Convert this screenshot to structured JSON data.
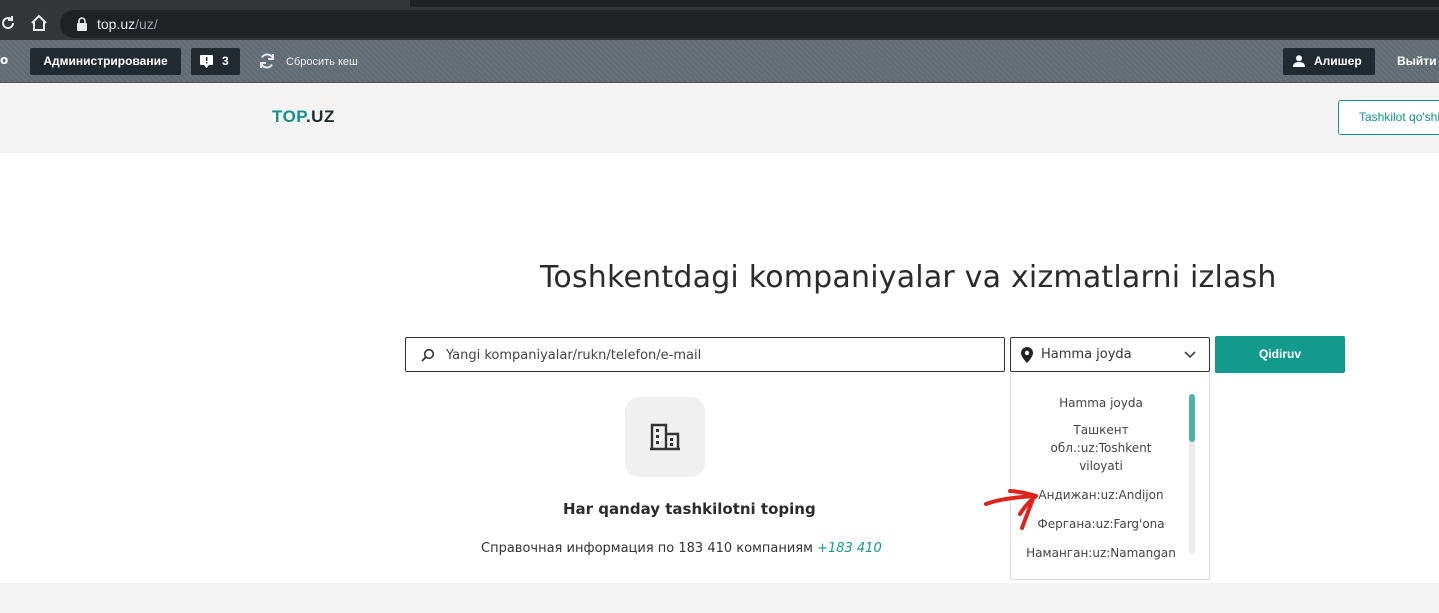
{
  "browser": {
    "url_host": "top.uz",
    "url_path": "/uz/"
  },
  "admin_bar": {
    "cut_label": "о",
    "admin_button": "Администрирование",
    "notifications_count": "3",
    "reset_cache": "Сбросить кеш",
    "user_name": "Алишер",
    "logout": "Выйти"
  },
  "header": {
    "logo_brand": "TOP",
    "logo_tld": ".UZ",
    "add_org_button": "Tashkilot qo'shish"
  },
  "search": {
    "headline": "Toshkentdagi kompaniyalar va xizmatlarni izlash",
    "placeholder": "Yangi kompaniyalar/rukn/telefon/e-mail",
    "location_value": "Hamma joyda",
    "submit": "Qidiruv",
    "location_options": [
      "Hamma joyda",
      "Ташкент обл.:uz:Toshkent viloyati",
      "Андижан:uz:Andijon",
      "Фергана:uz:Farg'ona",
      "Наманган:uz:Namangan"
    ]
  },
  "intro": {
    "title": "Har qanday tashkilotni toping",
    "info_text": "Справочная информация по 183 410 компаниям",
    "phone": "+183 410"
  },
  "colors": {
    "brand_teal": "#139a8c",
    "admin_dark": "#222a31",
    "annotation_red": "#e0231c"
  },
  "icons": {
    "reload": "reload-icon",
    "home": "home-icon",
    "lock": "lock-icon",
    "notification": "notification-icon",
    "refresh": "refresh-icon",
    "user": "user-icon",
    "search": "search-icon",
    "location": "map-pin-icon",
    "chevron": "chevron-down-icon",
    "building": "building-icon"
  }
}
